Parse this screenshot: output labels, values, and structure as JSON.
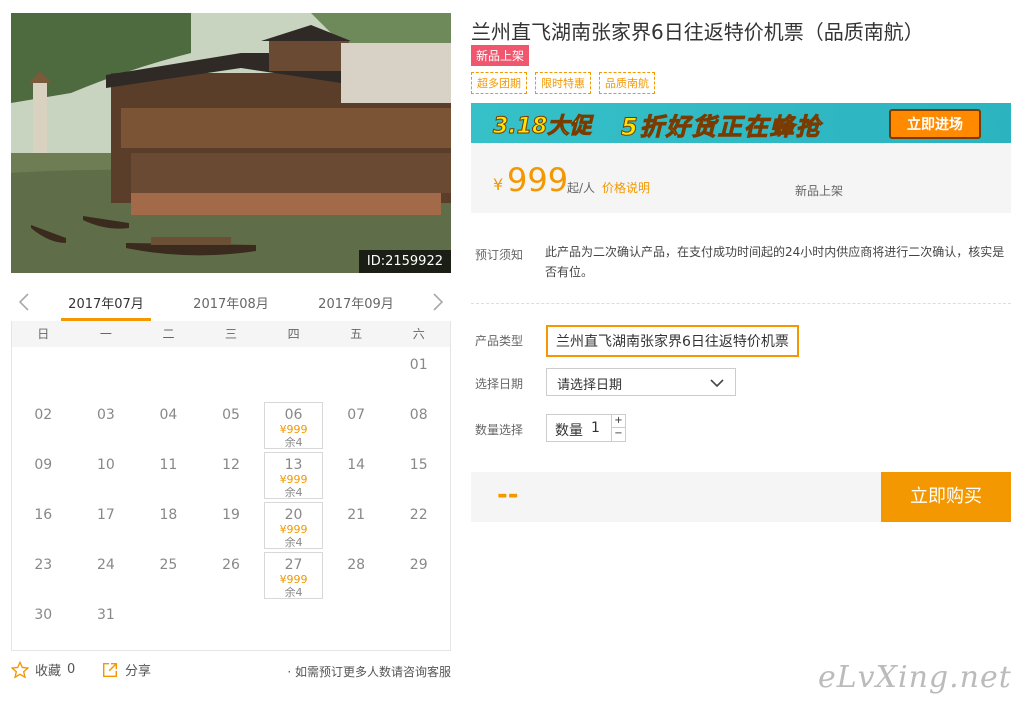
{
  "product": {
    "title": "兰州直飞湖南张家界6日往返特价机票（品质南航）",
    "badge": "新品上架",
    "tags": [
      "超多团期",
      "限时特惠",
      "品质南航"
    ],
    "photo_id": "ID:2159922"
  },
  "promo": {
    "left_text": "3.18大促",
    "middle_text": "5折好货正在蜂抢",
    "button_label": "立即进场"
  },
  "price": {
    "currency": "¥",
    "amount": "999",
    "unit": "起/人",
    "explain_link": "价格说明",
    "new_label": "新品上架"
  },
  "notice": {
    "label": "预订须知",
    "text": "此产品为二次确认产品，在支付成功时间起的24小时内供应商将进行二次确认，核实是否有位。"
  },
  "form": {
    "product_type_label": "产品类型",
    "product_type_value": "兰州直飞湖南张家界6日往返特价机票",
    "date_label": "选择日期",
    "date_placeholder": "请选择日期",
    "qty_label": "数量选择",
    "qty_inner_label": "数量",
    "qty_value": "1",
    "qty_plus": "+",
    "qty_minus": "−"
  },
  "buy": {
    "total": "--",
    "button_label": "立即购买"
  },
  "calendar": {
    "months": [
      "2017年07月",
      "2017年08月",
      "2017年09月"
    ],
    "active_month": 0,
    "weekdays": [
      "日",
      "一",
      "二",
      "三",
      "四",
      "五",
      "六"
    ],
    "cells": [
      {
        "day": ""
      },
      {
        "day": ""
      },
      {
        "day": ""
      },
      {
        "day": ""
      },
      {
        "day": ""
      },
      {
        "day": ""
      },
      {
        "day": "01"
      },
      {
        "day": "02"
      },
      {
        "day": "03"
      },
      {
        "day": "04"
      },
      {
        "day": "05"
      },
      {
        "day": "06",
        "price": "¥999",
        "left": "余4"
      },
      {
        "day": "07"
      },
      {
        "day": "08"
      },
      {
        "day": "09"
      },
      {
        "day": "10"
      },
      {
        "day": "11"
      },
      {
        "day": "12"
      },
      {
        "day": "13",
        "price": "¥999",
        "left": "余4"
      },
      {
        "day": "14"
      },
      {
        "day": "15"
      },
      {
        "day": "16"
      },
      {
        "day": "17"
      },
      {
        "day": "18"
      },
      {
        "day": "19"
      },
      {
        "day": "20",
        "price": "¥999",
        "left": "余4"
      },
      {
        "day": "21"
      },
      {
        "day": "22"
      },
      {
        "day": "23"
      },
      {
        "day": "24"
      },
      {
        "day": "25"
      },
      {
        "day": "26"
      },
      {
        "day": "27",
        "price": "¥999",
        "left": "余4"
      },
      {
        "day": "28"
      },
      {
        "day": "29"
      },
      {
        "day": "30"
      },
      {
        "day": "31"
      }
    ]
  },
  "actions": {
    "favorite_label": "收藏",
    "favorite_count": "0",
    "share_label": "分享",
    "note": "· 如需预订更多人数请咨询客服"
  },
  "watermark": "eLvXing.net",
  "colors": {
    "accent": "#f39800",
    "badge": "#f1566f"
  }
}
